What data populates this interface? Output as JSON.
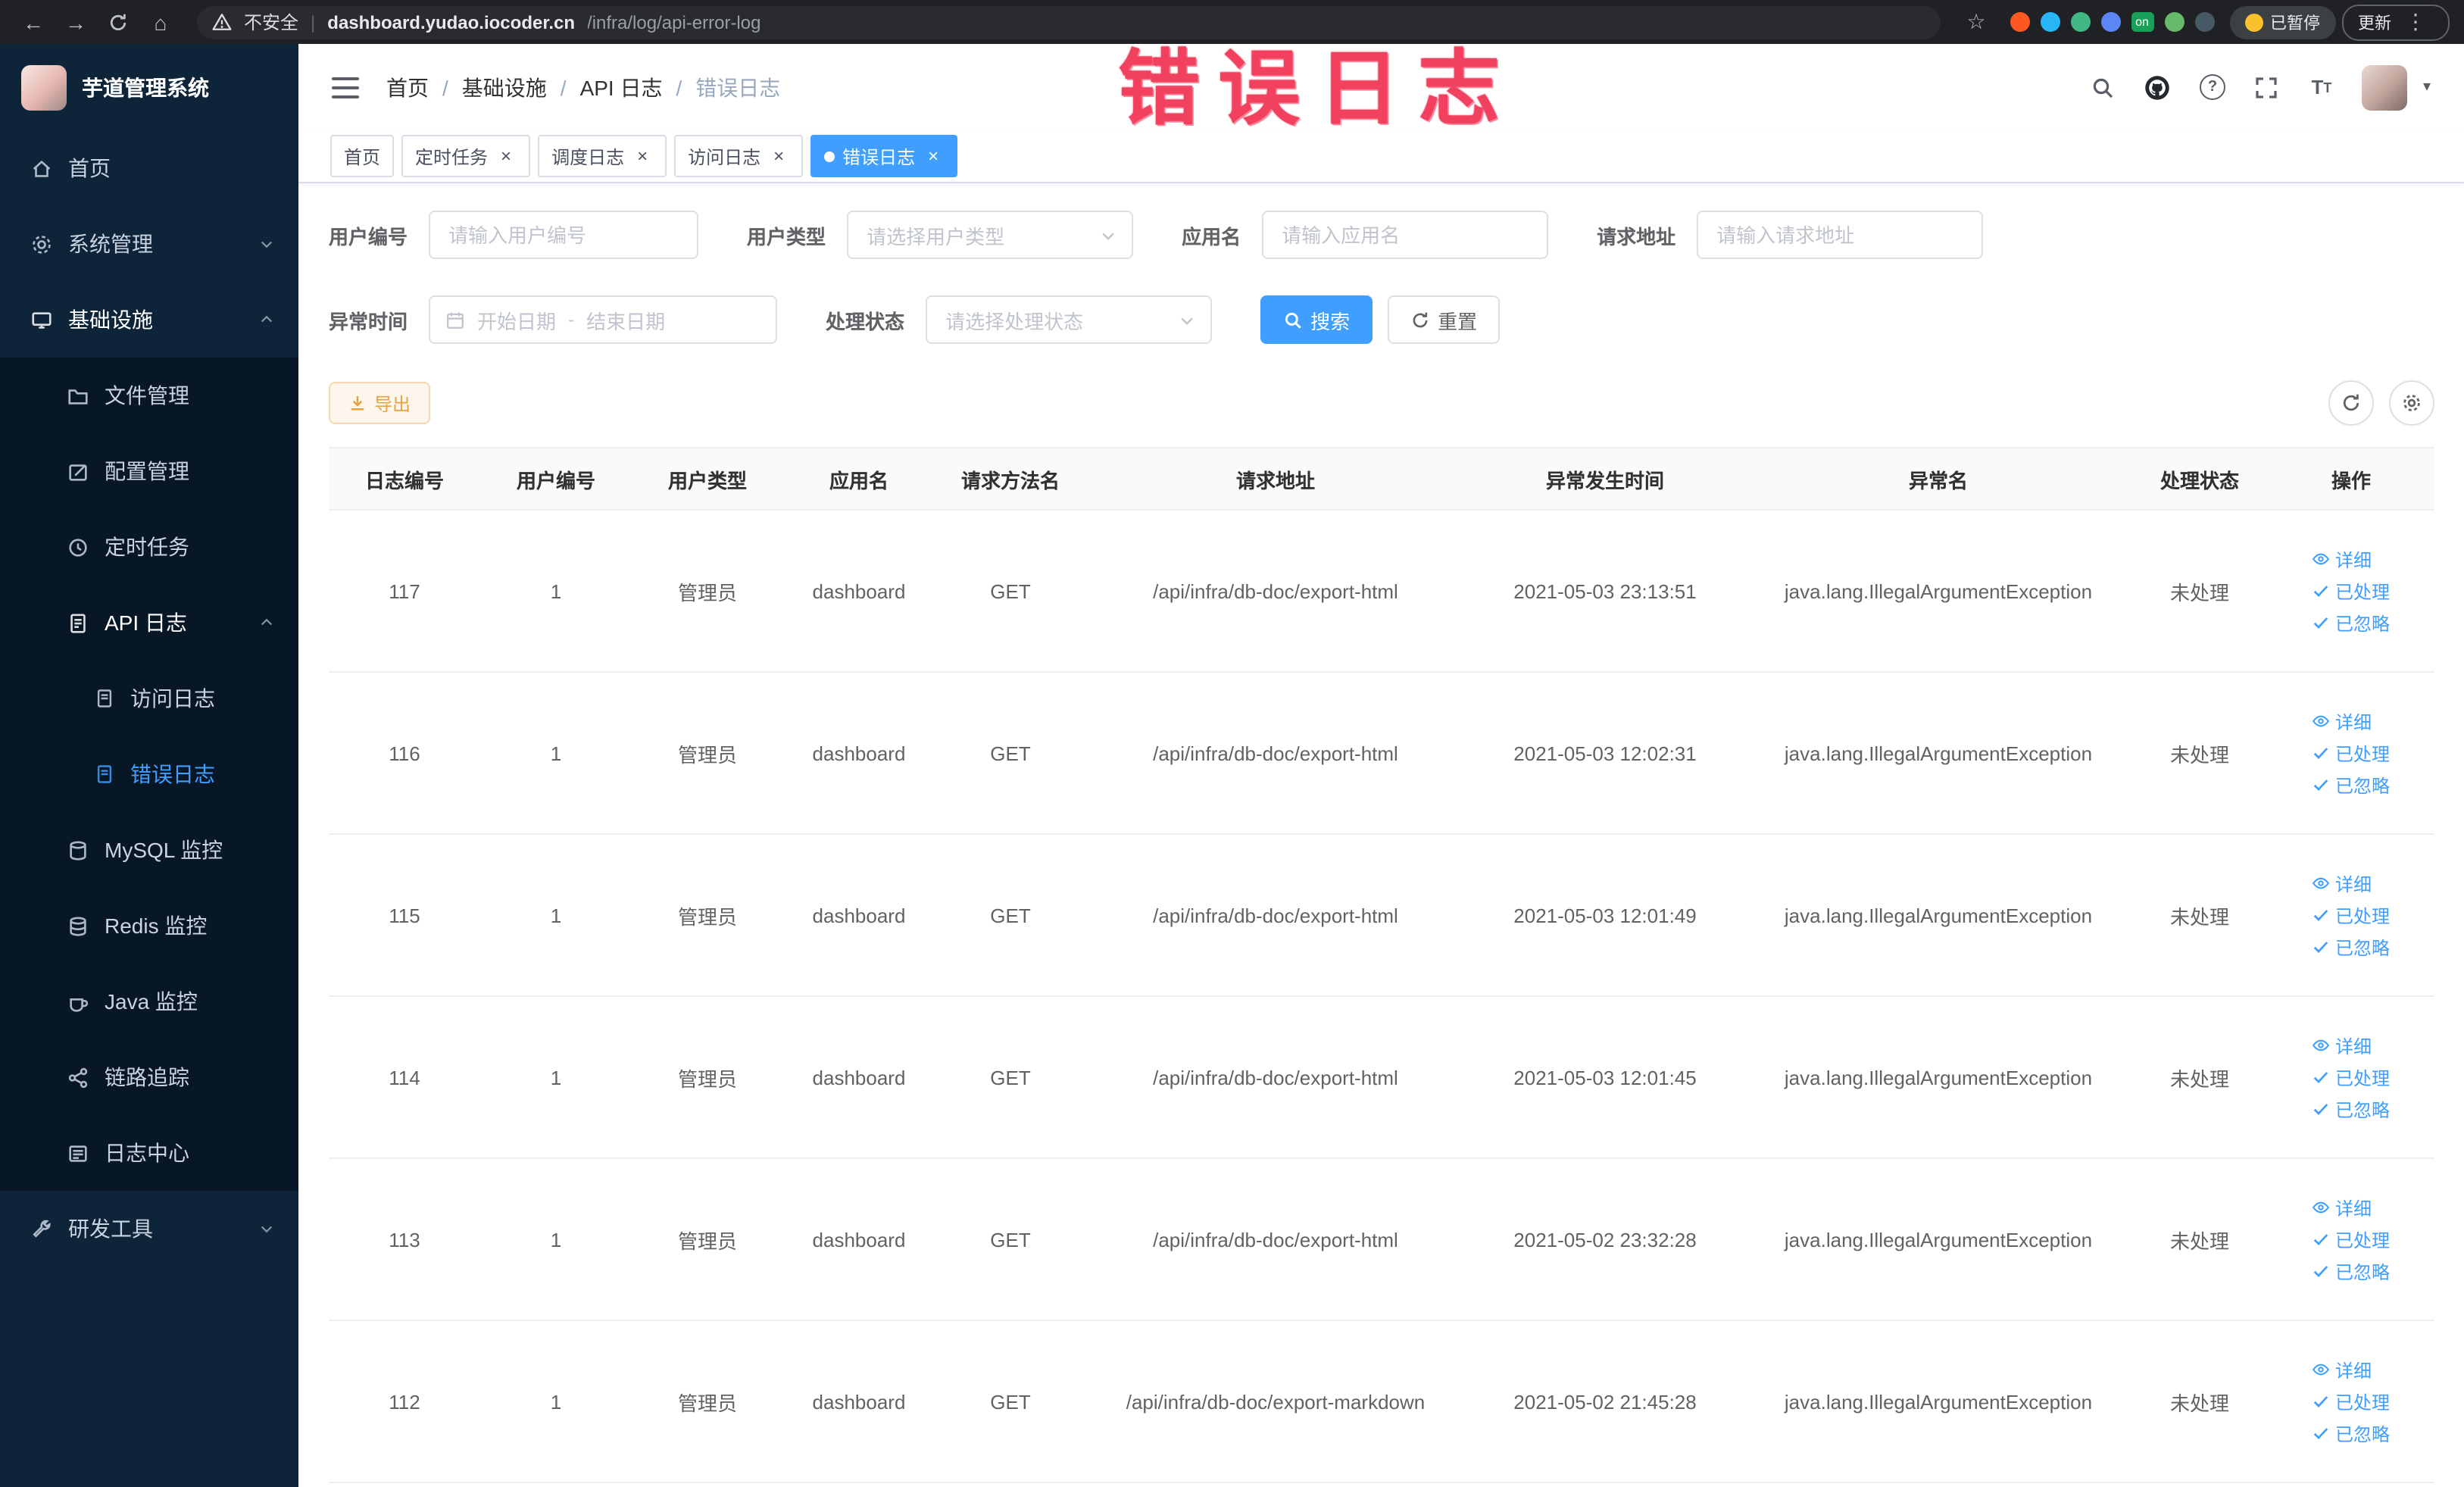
{
  "browser": {
    "security_label": "不安全",
    "url_domain": "dashboard.yudao.iocoder.cn",
    "url_path": "/infra/log/api-error-log",
    "extension_badge_on": "on",
    "paused_badge": "已暂停",
    "update_button": "更新"
  },
  "annotation": {
    "text": "错误日志",
    "color": "#f2415f"
  },
  "sidebar": {
    "logo_title": "芋道管理系统",
    "menu": {
      "home": "首页",
      "system": "系统管理",
      "infra": "基础设施",
      "file": "文件管理",
      "config": "配置管理",
      "job": "定时任务",
      "apilog": "API 日志",
      "accesslog": "访问日志",
      "errorlog": "错误日志",
      "mysql": "MySQL 监控",
      "redis": "Redis 监控",
      "java": "Java 监控",
      "trace": "链路追踪",
      "logcenter": "日志中心",
      "devtools": "研发工具"
    }
  },
  "breadcrumb": [
    "首页",
    "基础设施",
    "API 日志",
    "错误日志"
  ],
  "tabs": {
    "items": [
      {
        "label": "首页"
      },
      {
        "label": "定时任务"
      },
      {
        "label": "调度日志"
      },
      {
        "label": "访问日志"
      },
      {
        "label": "错误日志"
      }
    ]
  },
  "filters": {
    "user_id_label": "用户编号",
    "user_id_placeholder": "请输入用户编号",
    "user_type_label": "用户类型",
    "user_type_placeholder": "请选择用户类型",
    "app_label": "应用名",
    "app_placeholder": "请输入应用名",
    "url_label": "请求地址",
    "url_placeholder": "请输入请求地址",
    "time_label": "异常时间",
    "start_placeholder": "开始日期",
    "end_placeholder": "结束日期",
    "range_separator": "-",
    "status_label": "处理状态",
    "status_placeholder": "请选择处理状态",
    "search_button": "搜索",
    "reset_button": "重置"
  },
  "toolbar": {
    "export_button": "导出"
  },
  "table": {
    "headers": [
      "日志编号",
      "用户编号",
      "用户类型",
      "应用名",
      "请求方法名",
      "请求地址",
      "异常发生时间",
      "异常名",
      "处理状态",
      "操作"
    ],
    "actions": {
      "detail": "详细",
      "done": "已处理",
      "ignore": "已忽略"
    },
    "rows": [
      {
        "id": "117",
        "user_id": "1",
        "user_type": "管理员",
        "app": "dashboard",
        "method": "GET",
        "url": "/api/infra/db-doc/export-html",
        "time": "2021-05-03 23:13:51",
        "exception": "java.lang.IllegalArgumentException",
        "status": "未处理"
      },
      {
        "id": "116",
        "user_id": "1",
        "user_type": "管理员",
        "app": "dashboard",
        "method": "GET",
        "url": "/api/infra/db-doc/export-html",
        "time": "2021-05-03 12:02:31",
        "exception": "java.lang.IllegalArgumentException",
        "status": "未处理"
      },
      {
        "id": "115",
        "user_id": "1",
        "user_type": "管理员",
        "app": "dashboard",
        "method": "GET",
        "url": "/api/infra/db-doc/export-html",
        "time": "2021-05-03 12:01:49",
        "exception": "java.lang.IllegalArgumentException",
        "status": "未处理"
      },
      {
        "id": "114",
        "user_id": "1",
        "user_type": "管理员",
        "app": "dashboard",
        "method": "GET",
        "url": "/api/infra/db-doc/export-html",
        "time": "2021-05-03 12:01:45",
        "exception": "java.lang.IllegalArgumentException",
        "status": "未处理"
      },
      {
        "id": "113",
        "user_id": "1",
        "user_type": "管理员",
        "app": "dashboard",
        "method": "GET",
        "url": "/api/infra/db-doc/export-html",
        "time": "2021-05-02 23:32:28",
        "exception": "java.lang.IllegalArgumentException",
        "status": "未处理"
      },
      {
        "id": "112",
        "user_id": "1",
        "user_type": "管理员",
        "app": "dashboard",
        "method": "GET",
        "url": "/api/infra/db-doc/export-markdown",
        "time": "2021-05-02 21:45:28",
        "exception": "java.lang.IllegalArgumentException",
        "status": "未处理"
      }
    ]
  }
}
